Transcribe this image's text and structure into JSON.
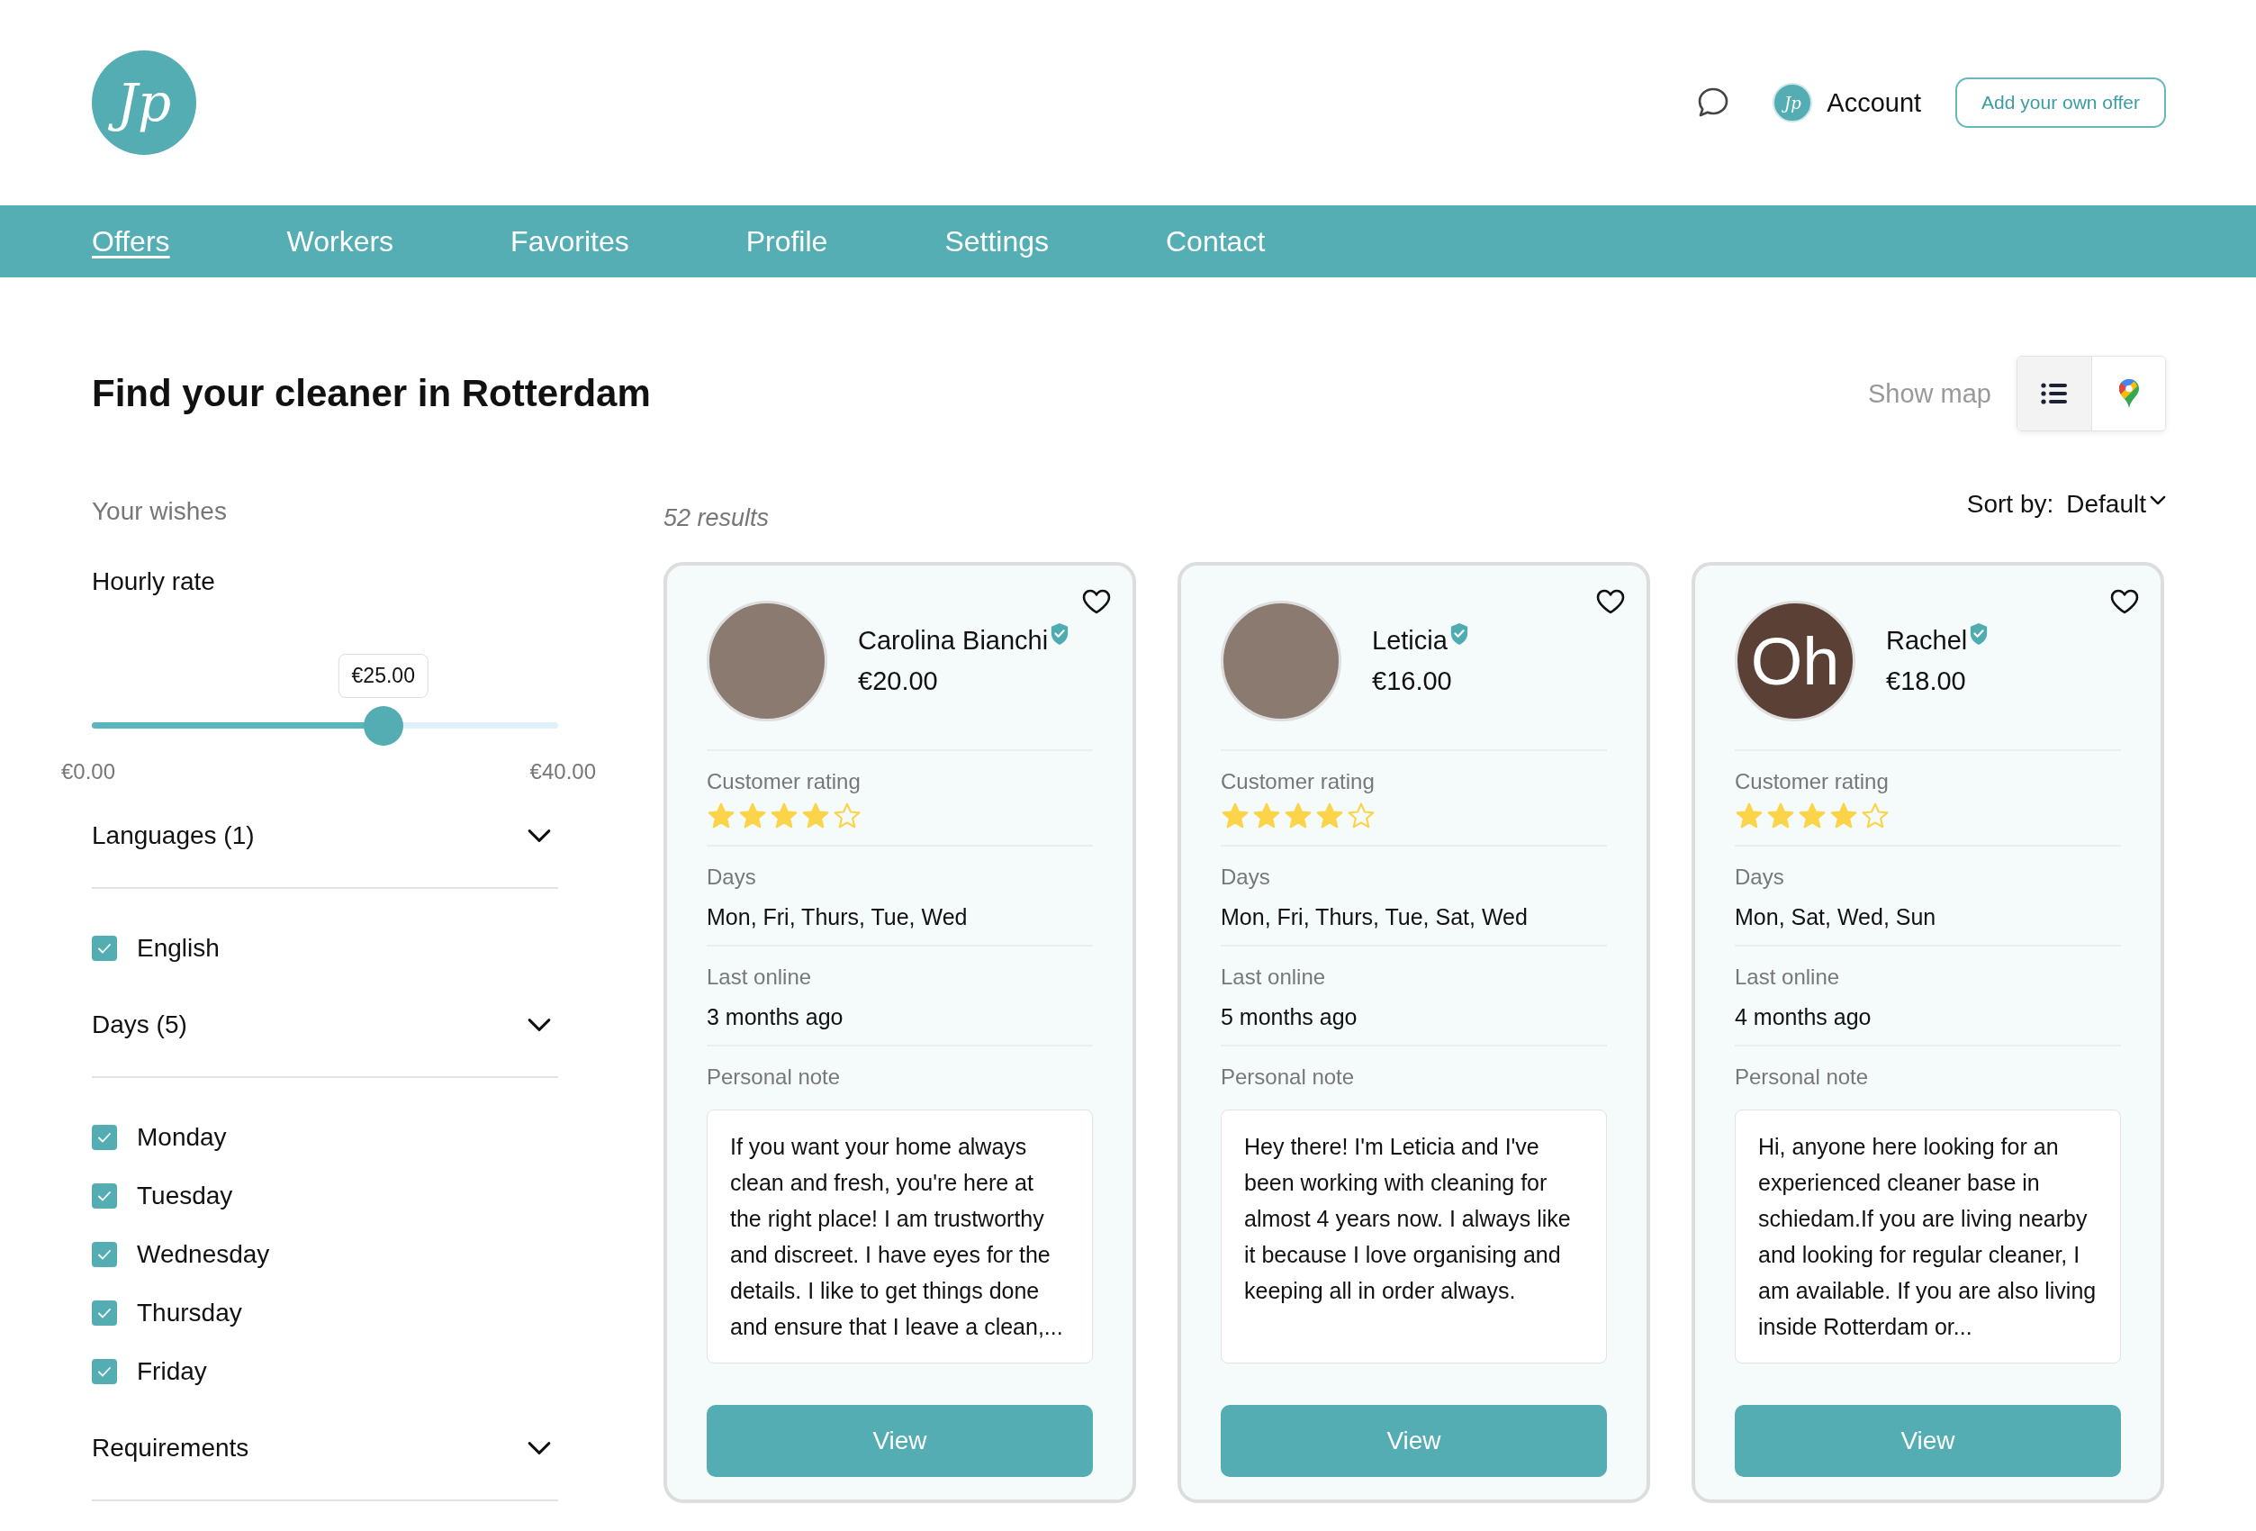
{
  "header": {
    "logo": "Jp",
    "account": {
      "avatar": "Jp",
      "label": "Account"
    },
    "offer_button": "Add your own offer"
  },
  "nav": [
    {
      "label": "Offers",
      "selected": true
    },
    {
      "label": "Workers",
      "selected": false
    },
    {
      "label": "Favorites",
      "selected": false
    },
    {
      "label": "Profile",
      "selected": false
    },
    {
      "label": "Settings",
      "selected": false
    },
    {
      "label": "Contact",
      "selected": false
    }
  ],
  "title": "Find your cleaner in Rotterdam",
  "view_toggle": {
    "label": "Show map",
    "options": [
      {
        "kind": "list",
        "selected": true
      },
      {
        "kind": "map",
        "selected": false
      }
    ]
  },
  "filters": {
    "heading": "Your wishes",
    "sections": [
      {
        "kind": "range",
        "title": "Hourly rate",
        "value": "€25.00",
        "level": 0.625,
        "min": "€0.00",
        "max": "€40.00"
      },
      {
        "kind": "group",
        "title": "Languages (1)",
        "options": [
          {
            "label": "English",
            "checked": true
          }
        ]
      },
      {
        "kind": "group",
        "title": "Days (5)",
        "options": [
          {
            "label": "Monday",
            "checked": true
          },
          {
            "label": "Tuesday",
            "checked": true
          },
          {
            "label": "Wednesday",
            "checked": true
          },
          {
            "label": "Thursday",
            "checked": true
          },
          {
            "label": "Friday",
            "checked": true
          }
        ]
      },
      {
        "kind": "group",
        "title": "Requirements"
      }
    ]
  },
  "results": {
    "count": "52 results",
    "sort_label": "Sort by:",
    "sort_value": "Default"
  },
  "cards": [
    {
      "avatar": {
        "kind": "photo"
      },
      "name": "Carolina Bianchi",
      "verified": true,
      "price": "€20.00",
      "rating_label": "Customer rating",
      "stars": 4,
      "days_label": "Days",
      "days": "Mon, Fri, Thurs, Tue, Wed",
      "online_label": "Last online",
      "online": "3 months ago",
      "note_label": "Personal note",
      "note": "If you want your home always clean and fresh, you're here at the right place! I am trustworthy and discreet. I have eyes for the details. I like to get things done and ensure that I leave a clean,...",
      "button": "View"
    },
    {
      "avatar": {
        "kind": "photo"
      },
      "name": "Leticia",
      "verified": true,
      "price": "€16.00",
      "rating_label": "Customer rating",
      "stars": 4,
      "days_label": "Days",
      "days": "Mon, Fri, Thurs, Tue, Sat, Wed",
      "online_label": "Last online",
      "online": "5 months ago",
      "note_label": "Personal note",
      "note": "Hey there! I'm Leticia and I've been working with cleaning for almost 4 years now. I always like it because I love organising and keeping all in order always.",
      "button": "View"
    },
    {
      "avatar": {
        "kind": "initials",
        "text": "Oh"
      },
      "name": "Rachel",
      "verified": true,
      "price": "€18.00",
      "rating_label": "Customer rating",
      "stars": 4,
      "days_label": "Days",
      "days": "Mon, Sat, Wed, Sun",
      "online_label": "Last online",
      "online": "4 months ago",
      "note_label": "Personal note",
      "note": "Hi, anyone here looking for an experienced cleaner base in schiedam.If you are living nearby and looking for regular cleaner, I am available. If you are also living inside Rotterdam or...",
      "button": "View"
    }
  ]
}
